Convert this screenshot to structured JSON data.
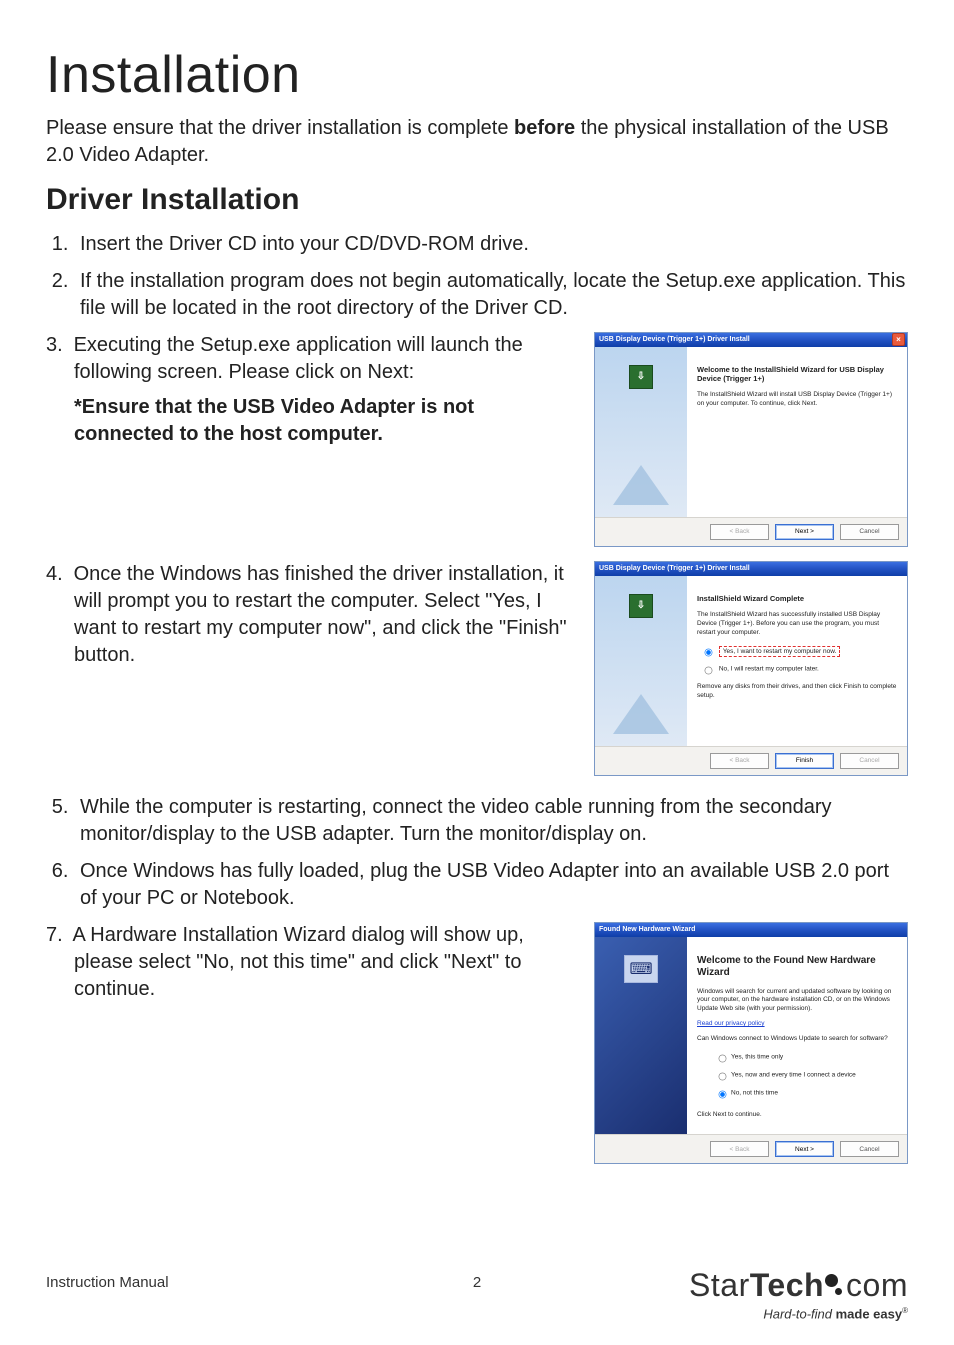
{
  "page": {
    "title": "Installation",
    "intro_pre": "Please ensure that the driver installation is complete ",
    "intro_bold": "before",
    "intro_post": " the physical installation of the USB 2.0 Video Adapter.",
    "section_heading": "Driver Installation",
    "footer_label": "Instruction Manual",
    "page_number": "2",
    "logo_line1_a": "Star",
    "logo_line1_b": "Tech",
    "logo_line1_c": "com",
    "tagline_a": "Hard-to-find ",
    "tagline_b": "made easy",
    "tagline_reg": "®"
  },
  "steps": {
    "s1": "Insert the Driver CD into your CD/DVD-ROM drive.",
    "s2": "If the installation program does not begin automatically, locate the Setup.exe application. This file will be located in the root directory of the Driver CD.",
    "s3_num": "3.",
    "s3": "Executing the Setup.exe application will launch the following screen. Please click on Next:",
    "s3_note": "*Ensure that the USB Video Adapter is not connected to the host computer.",
    "s4_num": "4.",
    "s4": "Once the Windows has finished the driver installation, it will prompt you to restart the computer. Select \"Yes, I want to restart my computer now\", and click the \"Finish\" button.",
    "s5": "While the computer is restarting, connect the video cable running from the secondary monitor/display to the USB adapter. Turn the monitor/display on.",
    "s6": "Once Windows has fully loaded, plug the USB Video Adapter into an available USB 2.0 port of your PC or Notebook.",
    "s7_num": "7.",
    "s7": "A Hardware Installation Wizard dialog will show up, please select \"No, not this time\" and click \"Next\" to continue."
  },
  "wizard1": {
    "title": "USB Display Device (Trigger 1+) Driver Install",
    "heading": "Welcome to the InstallShield Wizard for USB Display Device (Trigger 1+)",
    "body": "The InstallShield Wizard will install USB Display Device (Trigger 1+) on your computer.  To continue, click Next.",
    "back": "< Back",
    "next": "Next >",
    "cancel": "Cancel"
  },
  "wizard2": {
    "title": "USB Display Device (Trigger 1+) Driver Install",
    "heading": "InstallShield Wizard Complete",
    "body1": "The InstallShield Wizard has successfully installed USB Display Device (Trigger 1+).  Before you can use the program, you must restart your computer.",
    "radio1": "Yes, I want to restart my computer now.",
    "radio2": "No, I will restart my computer later.",
    "body2": "Remove any disks from their drives, and then click Finish to complete setup.",
    "back": "< Back",
    "finish": "Finish",
    "cancel": "Cancel"
  },
  "wizard3": {
    "title": "Found New Hardware Wizard",
    "heading": "Welcome to the Found New Hardware Wizard",
    "body1": "Windows will search for current and updated software by looking on your computer, on the hardware installation CD, or on the Windows Update Web site (with your permission).",
    "link": "Read our privacy policy",
    "body2": "Can Windows connect to Windows Update to search for software?",
    "radio1": "Yes, this time only",
    "radio2": "Yes, now and every time I connect a device",
    "radio3": "No, not this time",
    "body3": "Click Next to continue.",
    "back": "< Back",
    "next": "Next >",
    "cancel": "Cancel"
  }
}
